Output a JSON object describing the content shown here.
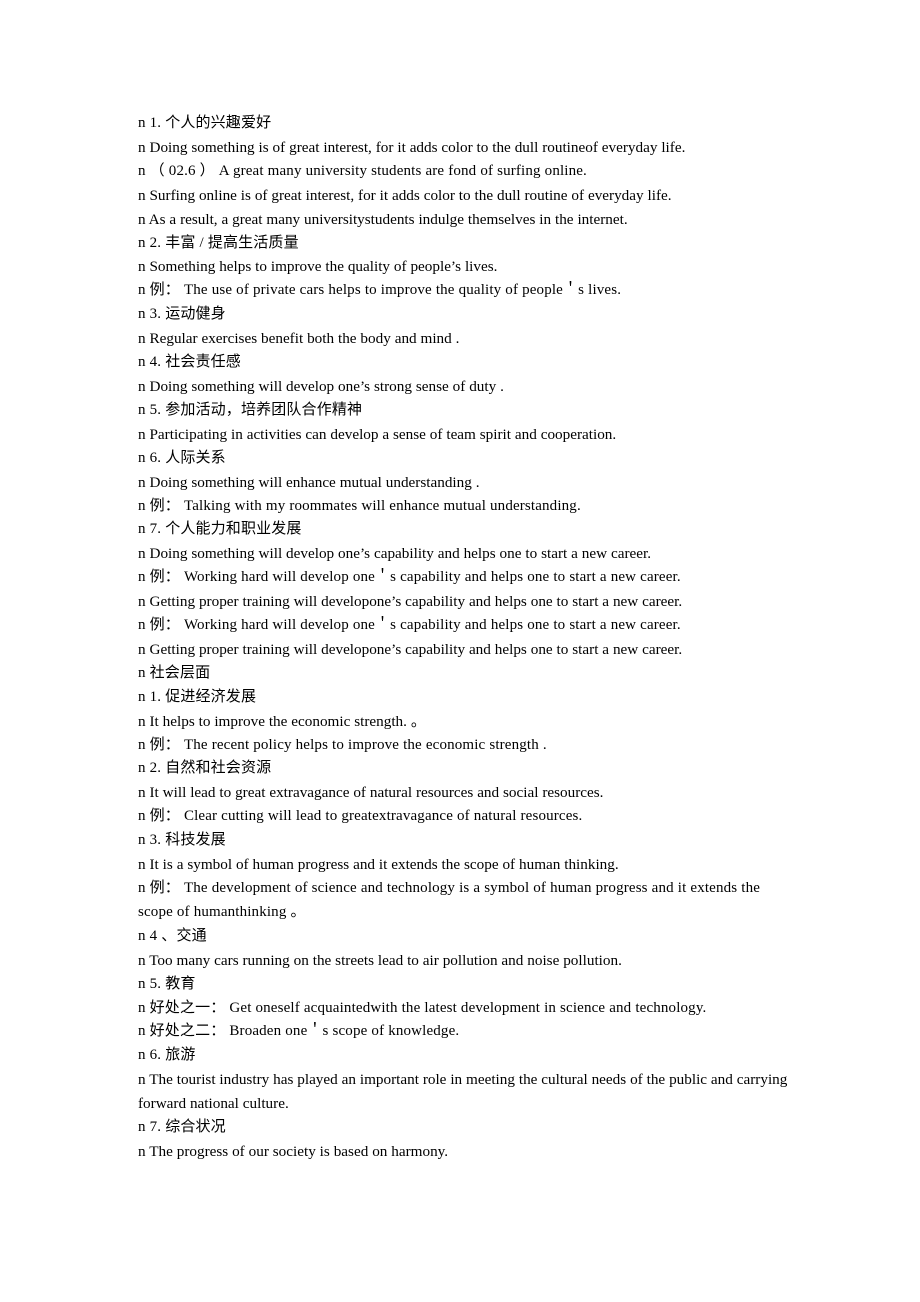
{
  "document": {
    "background_color": "#ffffff",
    "text_color": "#000000",
    "bullet_marker": "n",
    "lines": [
      {
        "id": "l1",
        "text": "n 1. 个人的兴趣爱好"
      },
      {
        "id": "l2",
        "text": "n Doing something is of great interest, for it adds color to the dull routineof everyday life."
      },
      {
        "id": "l3",
        "text": "n （ 02.6 ）  A great many university students are fond of surfing online."
      },
      {
        "id": "l4",
        "text": "n Surfing online is of great interest, for it adds color to the dull routine of everyday life."
      },
      {
        "id": "l5",
        "text": "n As a result, a great many universitystudents indulge themselves in the internet."
      },
      {
        "id": "l6",
        "text": "n 2. 丰富 / 提高生活质量"
      },
      {
        "id": "l7",
        "text": "n Something helps to improve the quality of people’s lives."
      },
      {
        "id": "l8",
        "text": "n 例：  The use of private cars helps to improve the quality of people＇s lives."
      },
      {
        "id": "l9",
        "text": "n 3. 运动健身"
      },
      {
        "id": "l10",
        "text": "n Regular exercises benefit both the body and mind ."
      },
      {
        "id": "l11",
        "text": "n 4. 社会责任感"
      },
      {
        "id": "l12",
        "text": "n Doing something will develop one’s strong sense of duty ."
      },
      {
        "id": "l13",
        "text": "n 5. 参加活动，培养团队合作精神"
      },
      {
        "id": "l14",
        "text": "n Participating in activities can develop a sense of team spirit and cooperation."
      },
      {
        "id": "l15",
        "text": "n 6. 人际关系"
      },
      {
        "id": "l16",
        "text": "n Doing something will enhance mutual understanding ."
      },
      {
        "id": "l17",
        "text": "n 例：  Talking with my roommates will enhance mutual understanding."
      },
      {
        "id": "l18",
        "text": "n 7. 个人能力和职业发展"
      },
      {
        "id": "l19",
        "text": "n Doing something will develop one’s capability and helps one to start a new career."
      },
      {
        "id": "l20",
        "text": "n 例：  Working hard will develop one＇s capability and helps one to start a new career."
      },
      {
        "id": "l21",
        "text": "n Getting proper training will developone’s capability and helps one to start a new career."
      },
      {
        "id": "l22",
        "text": "n 例：  Working hard will develop one＇s capability and helps one to start a new career."
      },
      {
        "id": "l23",
        "text": "n Getting proper training will developone’s capability and helps one to start a new career."
      },
      {
        "id": "l24",
        "text": "n 社会层面"
      },
      {
        "id": "l25",
        "text": "n 1. 促进经济发展"
      },
      {
        "id": "l26",
        "text": "n It helps to improve the economic strength. 。"
      },
      {
        "id": "l27",
        "text": "n 例：  The recent policy helps to improve the economic strength ."
      },
      {
        "id": "l28",
        "text": "n 2. 自然和社会资源"
      },
      {
        "id": "l29",
        "text": "n It will lead to great extravagance of natural resources and social resources."
      },
      {
        "id": "l30",
        "text": "n 例：  Clear cutting will lead to greatextravagance of natural resources."
      },
      {
        "id": "l31",
        "text": "n 3. 科技发展"
      },
      {
        "id": "l32",
        "text": "n It is a symbol of human progress and it extends the scope of human thinking."
      },
      {
        "id": "l33",
        "text": "n 例：  The development of science and technology is a symbol of human progress and it extends the scope of humanthinking 。"
      },
      {
        "id": "l34",
        "text": "n 4 、交通"
      },
      {
        "id": "l35",
        "text": "n Too many cars running on the streets lead to air pollution and noise pollution."
      },
      {
        "id": "l36",
        "text": "n 5. 教育"
      },
      {
        "id": "l37",
        "text": "n 好处之一：  Get oneself acquaintedwith the latest development in science and technology."
      },
      {
        "id": "l38",
        "text": "n 好处之二：  Broaden one＇s scope of knowledge."
      },
      {
        "id": "l39",
        "text": "n 6. 旅游"
      },
      {
        "id": "l40",
        "text": "n The tourist industry has played an important role in meeting the cultural needs of the public and carrying forward national culture."
      },
      {
        "id": "l41",
        "text": "n 7. 综合状况"
      },
      {
        "id": "l42",
        "text": "n The progress of our society is based on harmony."
      }
    ]
  }
}
